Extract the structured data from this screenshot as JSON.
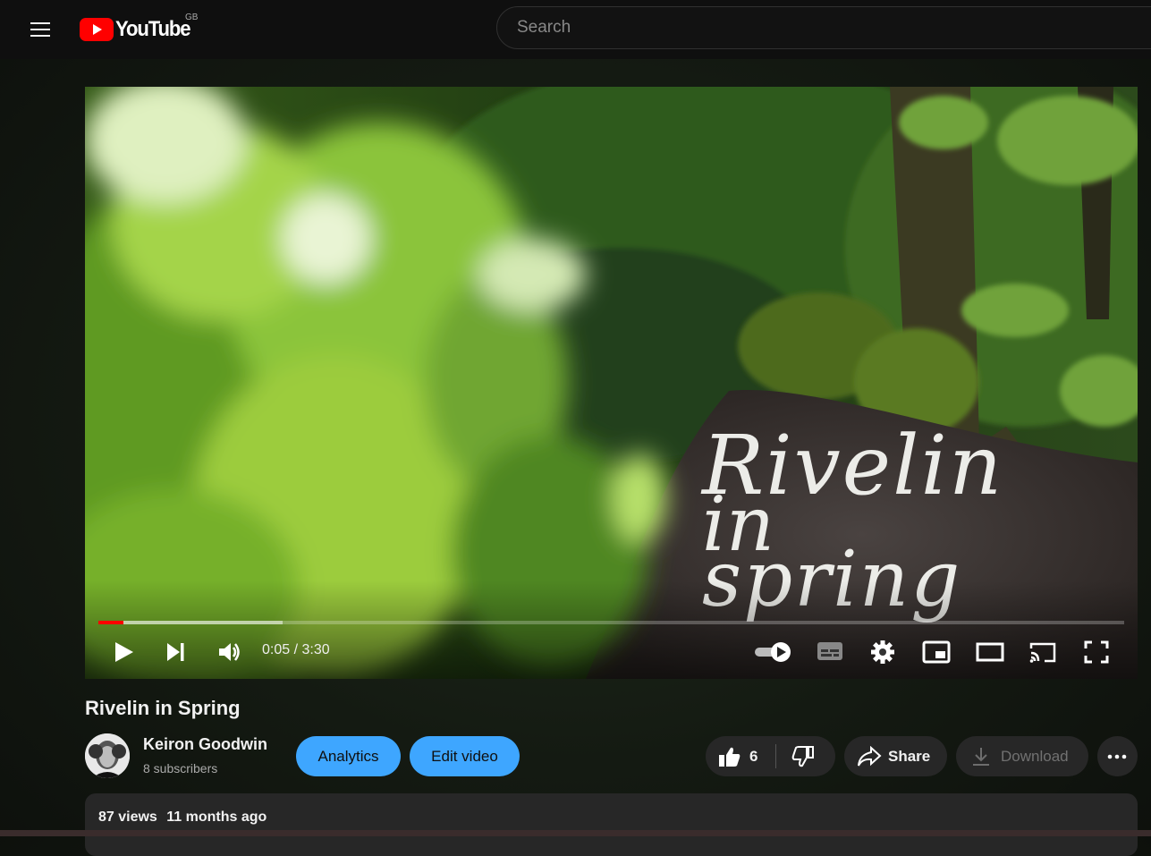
{
  "header": {
    "logo_text": "YouTube",
    "region": "GB",
    "search_placeholder": "Search"
  },
  "video": {
    "overlay_lines": [
      "Rivelin",
      "in",
      "spring"
    ],
    "current_time": "0:05",
    "duration": "3:30",
    "time_display": "0:05 / 3:30",
    "played_fraction": 0.024,
    "buffered_fraction": 0.18,
    "autoplay_on": true
  },
  "info": {
    "title": "Rivelin in Spring",
    "channel_name": "Keiron Goodwin",
    "subscribers": "8 subscribers",
    "analytics_label": "Analytics",
    "edit_label": "Edit video",
    "like_count": "6",
    "share_label": "Share",
    "download_label": "Download",
    "views": "87 views",
    "posted": "11 months ago"
  },
  "icons": [
    "menu-icon",
    "youtube-logo-icon",
    "play-icon",
    "next-icon",
    "volume-icon",
    "autoplay-toggle-icon",
    "subtitles-icon",
    "settings-gear-icon",
    "miniplayer-icon",
    "theater-mode-icon",
    "cast-icon",
    "fullscreen-icon",
    "thumbs-up-icon",
    "thumbs-down-icon",
    "share-arrow-icon",
    "download-icon",
    "more-options-icon"
  ],
  "colors": {
    "accent_red": "#ff0000",
    "button_blue": "#3ea6ff",
    "pill_bg": "#272727",
    "header_bg": "#0f0f0f"
  }
}
